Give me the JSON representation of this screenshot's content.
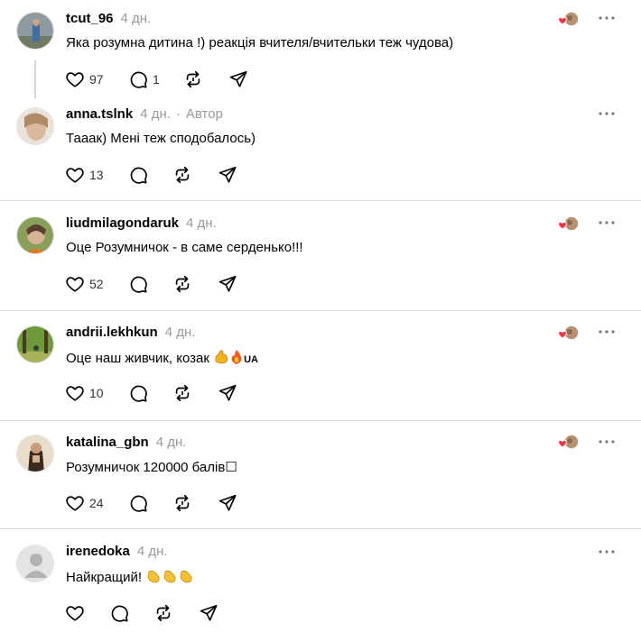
{
  "comments": [
    {
      "username": "tcut_96",
      "time": "4 дн.",
      "text": "Яка розумна дитина !) реакція вчителя/вчительки теж чудова)",
      "likes": "97",
      "replies": "1",
      "reposts": "",
      "liked_by_author": true,
      "avatar": "avatar-photo-outdoor"
    },
    {
      "username": "anna.tslnk",
      "time": "4 дн.",
      "author_label": "Автор",
      "text": "Тааак) Мені теж сподобалось)",
      "likes": "13",
      "replies": "",
      "reposts": "",
      "liked_by_author": false,
      "avatar": "avatar-photo-woman"
    },
    {
      "username": "liudmilagondaruk",
      "time": "4 дн.",
      "text": "Оце Розумничок - в саме серденько!!!",
      "likes": "52",
      "replies": "",
      "reposts": "",
      "liked_by_author": true,
      "avatar": "avatar-photo-woman-green"
    },
    {
      "username": "andrii.lekhkun",
      "time": "4 дн.",
      "text": "Оце наш живчик, козак",
      "text_suffix": "UA",
      "likes": "10",
      "replies": "",
      "reposts": "",
      "liked_by_author": true,
      "avatar": "avatar-photo-forest",
      "emojis": [
        "flexed-biceps",
        "fire"
      ]
    },
    {
      "username": "katalina_gbn",
      "time": "4 дн.",
      "text": "Розумничок 120000 балів☐",
      "likes": "24",
      "replies": "",
      "reposts": "",
      "liked_by_author": true,
      "avatar": "avatar-photo-woman-dark"
    },
    {
      "username": "irenedoka",
      "time": "4 дн.",
      "text": "Найкращий!",
      "likes": "",
      "replies": "",
      "reposts": "",
      "liked_by_author": false,
      "avatar": "default-avatar",
      "emojis": [
        "clapping-hands",
        "clapping-hands",
        "clapping-hands"
      ]
    }
  ],
  "colors": {
    "heart": "#ff3040",
    "meta": "#999999",
    "separator": "#dcdcdc"
  }
}
